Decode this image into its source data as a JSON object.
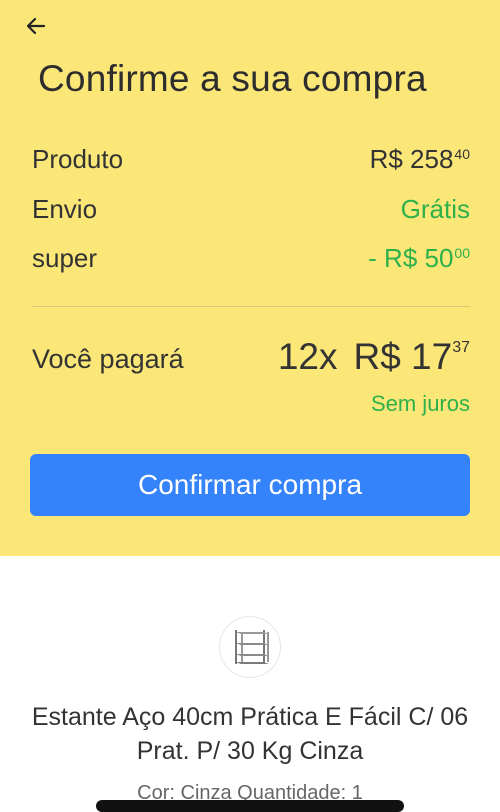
{
  "header": {
    "back_icon": "arrow-left-icon",
    "title": "Confirme a sua compra"
  },
  "summary": {
    "rows": [
      {
        "label": "Produto",
        "value_main": "R$ 258",
        "value_cents": "40",
        "color": "#333333"
      },
      {
        "label": "Envio",
        "value_main": "Grátis",
        "value_cents": "",
        "color": "#2eb14b"
      },
      {
        "label": "super",
        "value_main": "- R$ 50",
        "value_cents": "00",
        "color": "#2eb14b"
      }
    ]
  },
  "payment": {
    "label": "Você pagará",
    "installments": "12x",
    "amount_main": "R$ 17",
    "amount_cents": "37",
    "note": "Sem juros"
  },
  "confirm_button": {
    "label": "Confirmar compra",
    "color": "#3483fa"
  },
  "product": {
    "image_icon": "shelf-icon",
    "name": "Estante Aço 40cm Prática E Fácil C/ 06 Prat. P/ 30 Kg Cinza",
    "meta": "Cor: Cinza Quantidade: 1"
  },
  "colors": {
    "background_top": "#fbe678",
    "accent_green": "#2eb14b",
    "accent_blue": "#3483fa"
  }
}
